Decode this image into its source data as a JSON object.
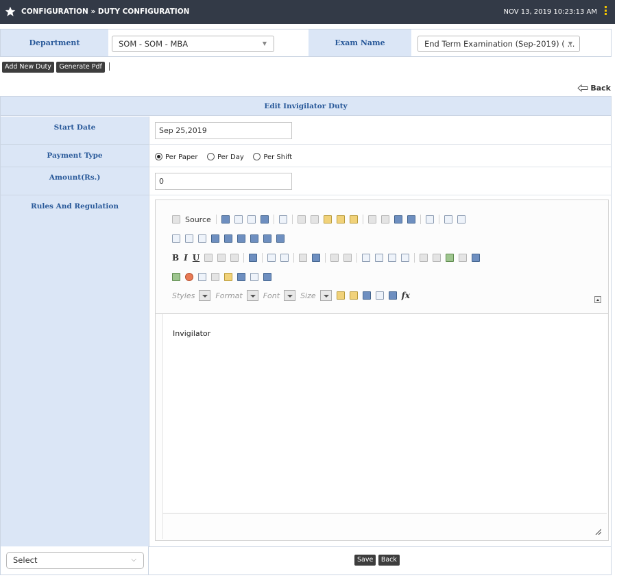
{
  "header": {
    "title": "CONFIGURATION » DUTY CONFIGURATION",
    "datetime": "NOV 13, 2019  10:23:13 AM",
    "icon": "star-icon",
    "menu_icon": "kebab-icon",
    "colors": {
      "bar": "#333a47",
      "accent": "#f5c600"
    }
  },
  "filters": {
    "department_label": "Department",
    "department_value": "SOM - SOM - MBA",
    "exam_label": "Exam Name",
    "exam_value": "End Term Examination (Sep-2019) ( ..."
  },
  "actions": {
    "add_new_duty": "Add New Duty",
    "generate_pdf": "Generate Pdf",
    "back": "Back"
  },
  "form": {
    "title": "Edit Invigilator Duty",
    "start_date_label": "Start Date",
    "start_date_value": "Sep 25,2019",
    "payment_type_label": "Payment Type",
    "payment_options": [
      "Per Paper",
      "Per Day",
      "Per Shift"
    ],
    "payment_selected": "Per Paper",
    "amount_label": "Amount(Rs.)",
    "amount_value": "0",
    "rules_label": "Rules And Regulation",
    "editor": {
      "source_label": "Source",
      "styles": "Styles",
      "format": "Format",
      "font": "Font",
      "size": "Size",
      "content": "Invigilator"
    },
    "footer_select": "Select",
    "save": "Save",
    "back": "Back"
  }
}
